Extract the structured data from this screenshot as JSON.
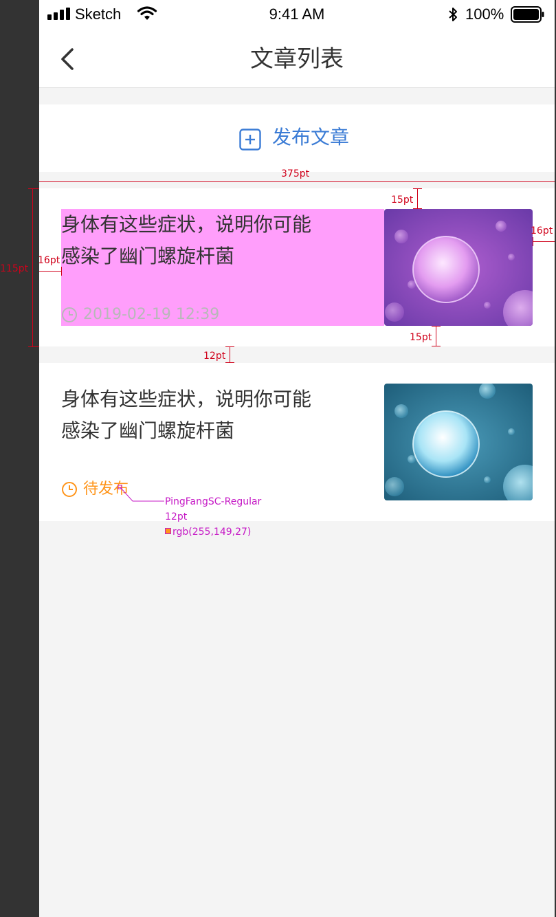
{
  "status_bar": {
    "carrier": "Sketch",
    "time": "9:41 AM",
    "battery": "100%",
    "icons": [
      "signal-icon",
      "wifi-icon",
      "bluetooth-icon",
      "battery-icon"
    ]
  },
  "nav": {
    "title": "文章列表",
    "back_icon": "chevron-left-icon"
  },
  "publish": {
    "label": "发布文章",
    "icon": "plus-square-icon",
    "color": "#3a7bd5"
  },
  "articles": [
    {
      "title_line1": "身体有这些症状，说明你可能",
      "title_line2": "感染了幽门螺旋杆菌",
      "meta": "2019-02-19 12:39",
      "meta_icon": "clock-icon",
      "meta_color": "#b8b8b8",
      "thumb": "purple-cell-image"
    },
    {
      "title_line1": "身体有这些症状，说明你可能",
      "title_line2": "感染了幽门螺旋杆菌",
      "meta": "待发布",
      "meta_icon": "clock-icon",
      "meta_color": "#ff951b",
      "thumb": "blue-cell-image"
    }
  ],
  "annotations": {
    "width": "375pt",
    "top_gap": "15pt",
    "right_gap": "16pt",
    "left_gap": "16pt",
    "card_height": "115pt",
    "bottom_gap": "15pt",
    "card_spacing": "12pt",
    "font_name": "PingFangSC-Regular",
    "font_size": "12pt",
    "font_color": "rgb(255,149,27)"
  },
  "colors": {
    "highlight": "#ff9efb",
    "annotation_red": "#d0021b",
    "annotation_magenta": "#c519c5",
    "pending_orange": "#ff951b"
  }
}
